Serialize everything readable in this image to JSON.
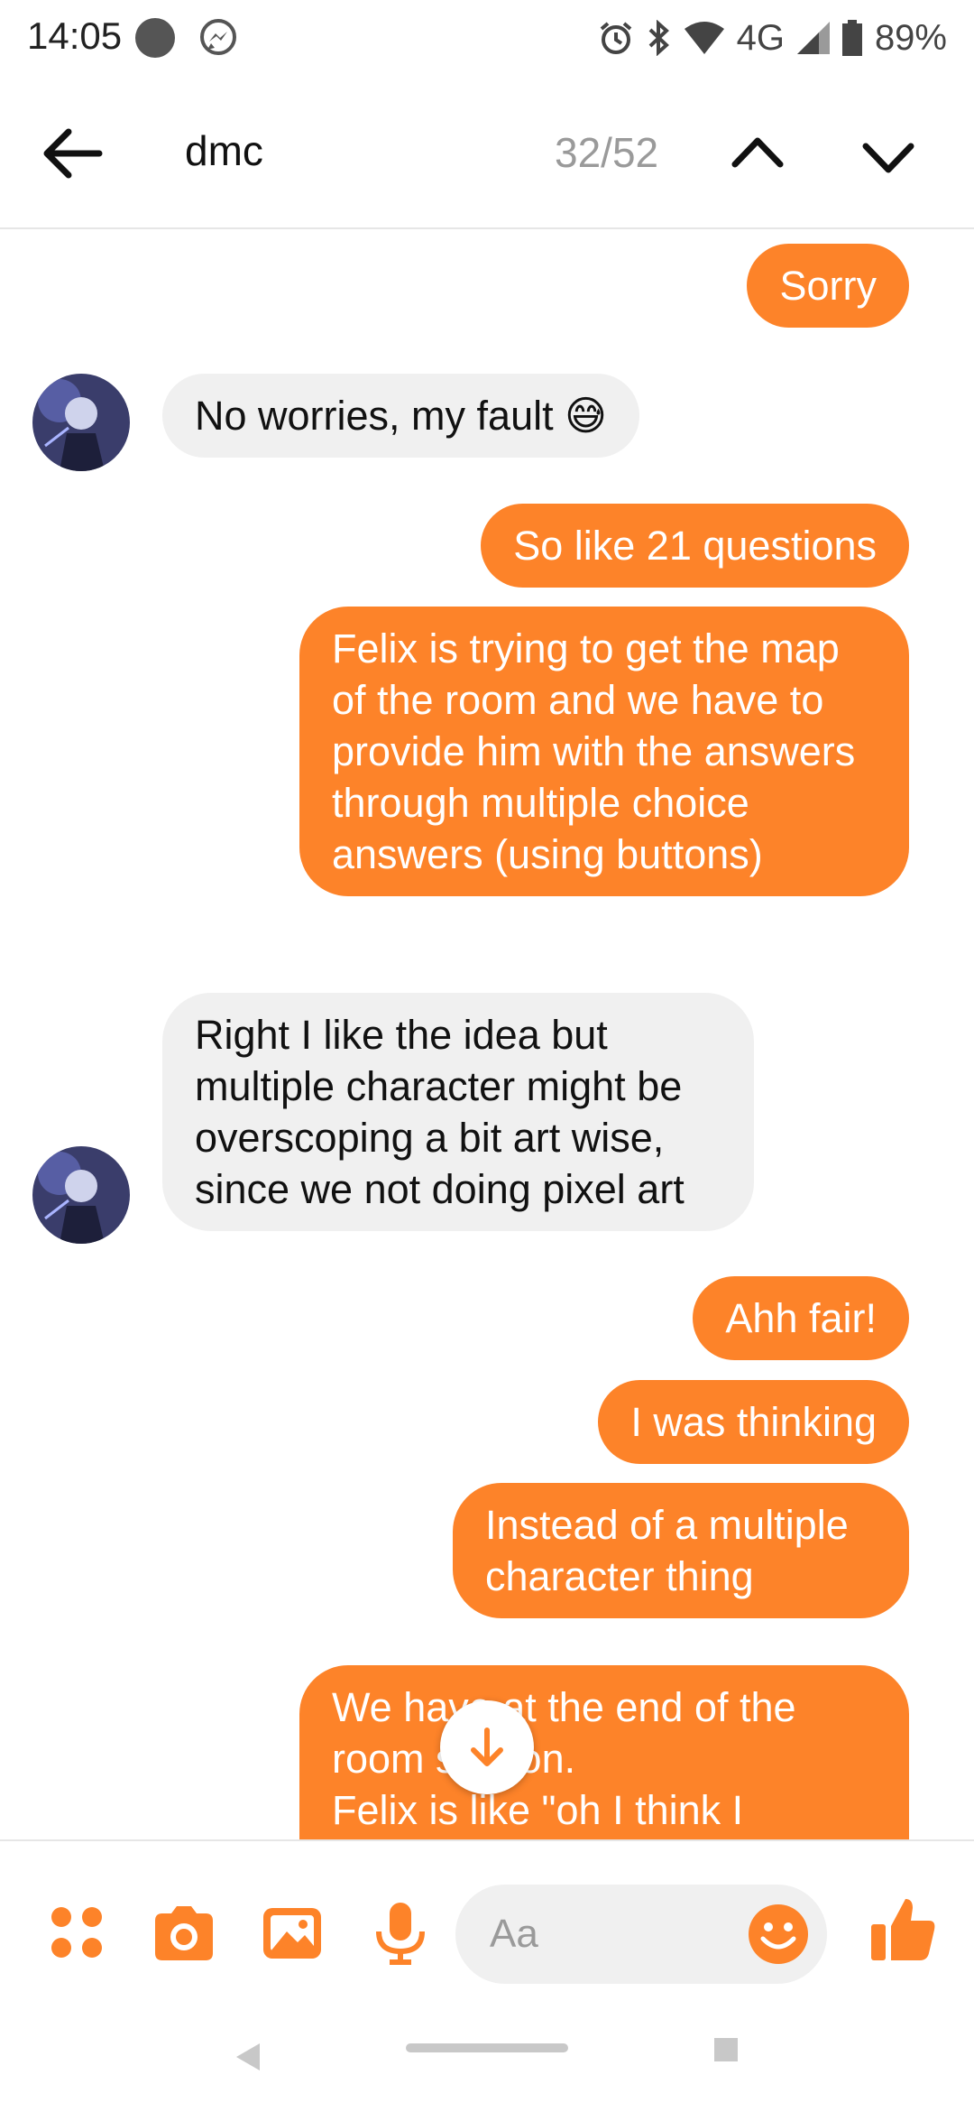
{
  "status_bar": {
    "time": "14:05",
    "network": "4G",
    "battery": "89%",
    "icons": [
      "notification-dot-icon",
      "messenger-icon",
      "alarm-icon",
      "bluetooth-icon",
      "wifi-icon",
      "signal-icon",
      "battery-icon"
    ]
  },
  "search": {
    "term": "dmc",
    "match_count": "32/52",
    "icons": [
      "back-arrow-icon",
      "chevron-up-icon",
      "chevron-down-icon"
    ]
  },
  "messages": [
    {
      "side": "out",
      "text": "Sorry"
    },
    {
      "side": "in",
      "text": "No worries, my fault 😅"
    },
    {
      "side": "out",
      "text": "So like 21 questions"
    },
    {
      "side": "out",
      "text": "Felix is trying to get the map of the room and we have to provide him with the answers through multiple choice answers (using buttons)"
    },
    {
      "side": "in",
      "text": "Right I like the idea but multiple character might be overscoping a bit art wise, since we not doing pixel art"
    },
    {
      "side": "out",
      "text": "Ahh fair!"
    },
    {
      "side": "out",
      "text": "I was thinking"
    },
    {
      "side": "out",
      "text": "Instead of a multiple character thing"
    },
    {
      "side": "out",
      "text": "We have at the end of the room section.\nFelix is like \"oh I think I"
    }
  ],
  "composer": {
    "placeholder": "Aa",
    "icons": [
      "apps-icon",
      "camera-icon",
      "gallery-icon",
      "microphone-icon",
      "emoji-icon",
      "thumbs-up-icon"
    ]
  },
  "colors": {
    "accent": "#fd8329",
    "incoming_bubble": "#f0f0f0",
    "muted_text": "#9a9a9a"
  }
}
